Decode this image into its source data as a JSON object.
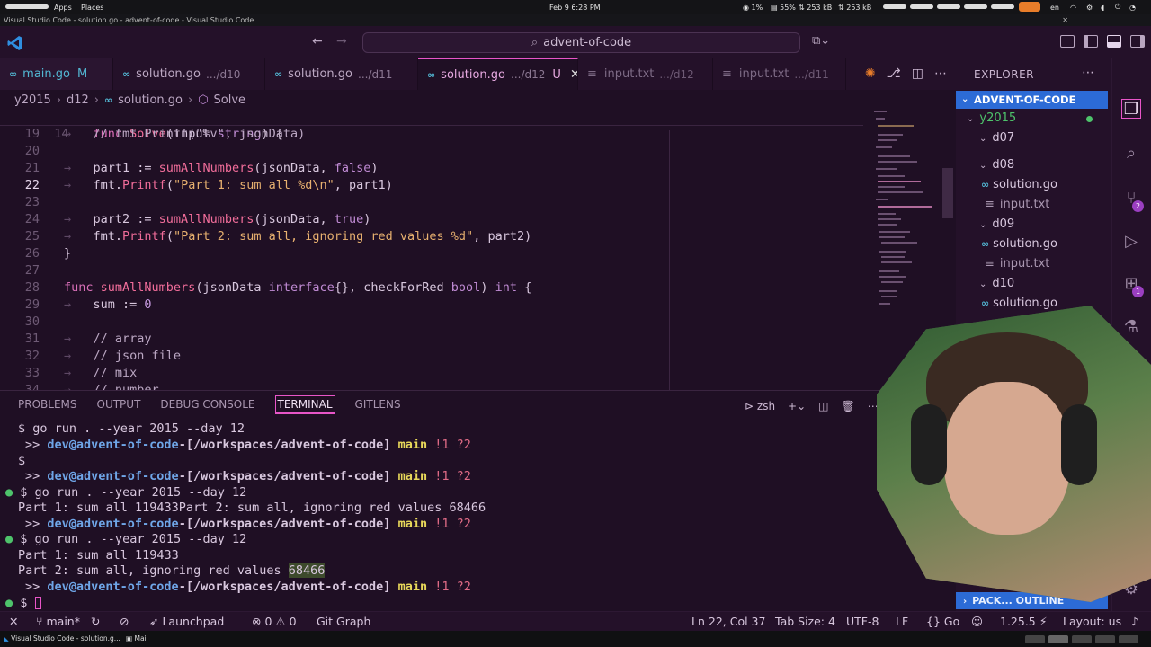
{
  "os": {
    "apps": "Apps",
    "places": "Places",
    "clock": "Feb 9   6:28 PM",
    "cpu": "1%",
    "mem": "55%",
    "net_down": "253 kB",
    "net_up": "253 kB",
    "lang": "en"
  },
  "window_title": "Visual Studio Code - solution.go - advent-of-code - Visual Studio Code",
  "command_center": {
    "text": "advent-of-code"
  },
  "tabs": [
    {
      "label": "main.go",
      "hint": "",
      "flag": "M",
      "state": "modified"
    },
    {
      "label": "solution.go",
      "hint": ".../d10",
      "flag": "",
      "state": "normal"
    },
    {
      "label": "solution.go",
      "hint": ".../d11",
      "flag": "",
      "state": "normal"
    },
    {
      "label": "solution.go",
      "hint": ".../d12",
      "flag": "U",
      "state": "active"
    },
    {
      "label": "input.txt",
      "hint": ".../d12",
      "flag": "",
      "state": "dim"
    },
    {
      "label": "input.txt",
      "hint": ".../d11",
      "flag": "",
      "state": "dim"
    }
  ],
  "breadcrumb": {
    "p1": "y2015",
    "p2": "d12",
    "p3": "solution.go",
    "p4": "Solve"
  },
  "editor": {
    "sticky": {
      "ln": "14",
      "code": "func Solve(input string) {"
    },
    "lines": [
      {
        "ln": "19",
        "code": "// fmt.Printf(\"%v\", jsonData)"
      },
      {
        "ln": "20",
        "code": ""
      },
      {
        "ln": "21",
        "code": "part1 := sumAllNumbers(jsonData, false)"
      },
      {
        "ln": "22",
        "code": "fmt.Printf(\"Part 1: sum all %d\\n\", part1)"
      },
      {
        "ln": "23",
        "code": ""
      },
      {
        "ln": "24",
        "code": "part2 := sumAllNumbers(jsonData, true)"
      },
      {
        "ln": "25",
        "code": "fmt.Printf(\"Part 2: sum all, ignoring red values %d\", part2)"
      },
      {
        "ln": "26",
        "code": "}"
      },
      {
        "ln": "27",
        "code": ""
      },
      {
        "ln": "28",
        "code": "func sumAllNumbers(jsonData interface{}, checkForRed bool) int {"
      },
      {
        "ln": "29",
        "code": "sum := 0"
      },
      {
        "ln": "30",
        "code": ""
      },
      {
        "ln": "31",
        "code": "// array"
      },
      {
        "ln": "32",
        "code": "// json file"
      },
      {
        "ln": "33",
        "code": "// mix"
      },
      {
        "ln": "34",
        "code": "// number"
      }
    ]
  },
  "panel": {
    "tabs": [
      "PROBLEMS",
      "OUTPUT",
      "DEBUG CONSOLE",
      "TERMINAL",
      "GITLENS"
    ],
    "active_tab": "TERMINAL",
    "shell": "zsh"
  },
  "terminal": {
    "cmd": "go run . --year 2015 --day 12",
    "user": "dev@advent-of-code",
    "path": "[/workspaces/advent-of-code]",
    "branch": "main",
    "git_status": "!1 ?2",
    "out1": "Part 1: sum all 119433Part 2: sum all, ignoring red values 68466",
    "out2": "Part 1: sum all 119433",
    "out3_prefix": "Part 2: sum all, ignoring red values ",
    "out3_value": "68466"
  },
  "explorer": {
    "title": "EXPLORER",
    "root": "ADVENT-OF-CODE",
    "items": {
      "y2015": "y2015",
      "d07": "d07",
      "d08": "d08",
      "d08_solution": "solution.go",
      "d08_input": "input.txt",
      "d09": "d09",
      "d09_solution": "solution.go",
      "d09_input": "input.txt",
      "d10": "d10",
      "d10_solution": "solution.go"
    },
    "outline": "PACK... OUTLINE"
  },
  "activity": {
    "scm_badge": "2",
    "ext_badge": "1"
  },
  "status": {
    "branch": "main*",
    "launchpad": "Launchpad",
    "errors": "0",
    "warnings": "0",
    "git_graph": "Git Graph",
    "cursor": "Ln 22, Col 37",
    "tab_size": "Tab Size: 4",
    "encoding": "UTF-8",
    "eol": "LF",
    "language": "Go",
    "go_version": "1.25.5",
    "layout": "Layout: us"
  },
  "dock": {
    "item1": "Visual Studio Code - solution.g...",
    "item2": "Mail"
  },
  "colors": {
    "accent": "#e855c8",
    "bg": "#1f0f24",
    "sidebar_sel": "#2c6bd6"
  }
}
